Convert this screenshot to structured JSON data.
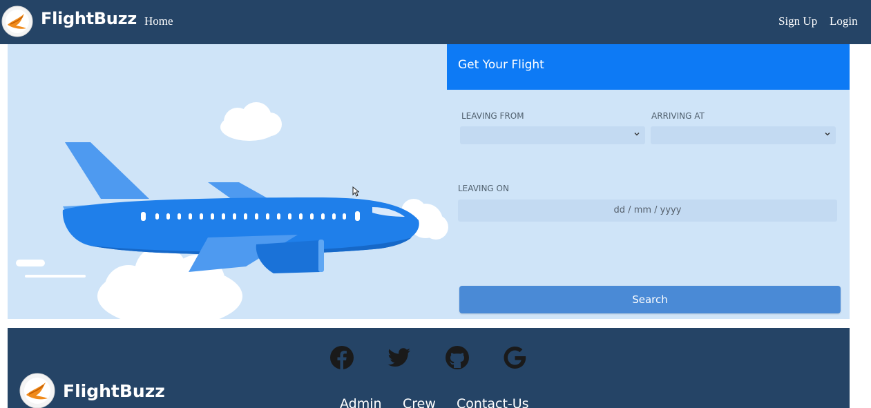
{
  "navbar": {
    "brand": "FlightBuzz",
    "home": "Home",
    "signup": "Sign Up",
    "login": "Login",
    "logo_icon": "bird-logo-icon"
  },
  "search_form": {
    "title": "Get Your Flight",
    "leaving_from_label": "LEAVING FROM",
    "leaving_from_value": "",
    "arriving_at_label": "ARRIVING AT",
    "arriving_at_value": "",
    "leaving_on_label": "LEAVING ON",
    "leaving_on_placeholder": "dd / mm / yyyy",
    "search_button": "Search"
  },
  "hero": {
    "illustration": "airplane-illustration"
  },
  "footer": {
    "brand": "FlightBuzz",
    "social_icons": [
      "facebook-icon",
      "twitter-icon",
      "github-icon",
      "google-icon"
    ],
    "links": [
      "Admin",
      "Crew",
      "Contact-Us"
    ]
  },
  "colors": {
    "navbar_bg": "#254466",
    "hero_bg": "#cfe4f8",
    "form_header_bg": "#0d7af5",
    "button_bg": "#4a8ad6",
    "plane_blue": "#1f7fea"
  }
}
